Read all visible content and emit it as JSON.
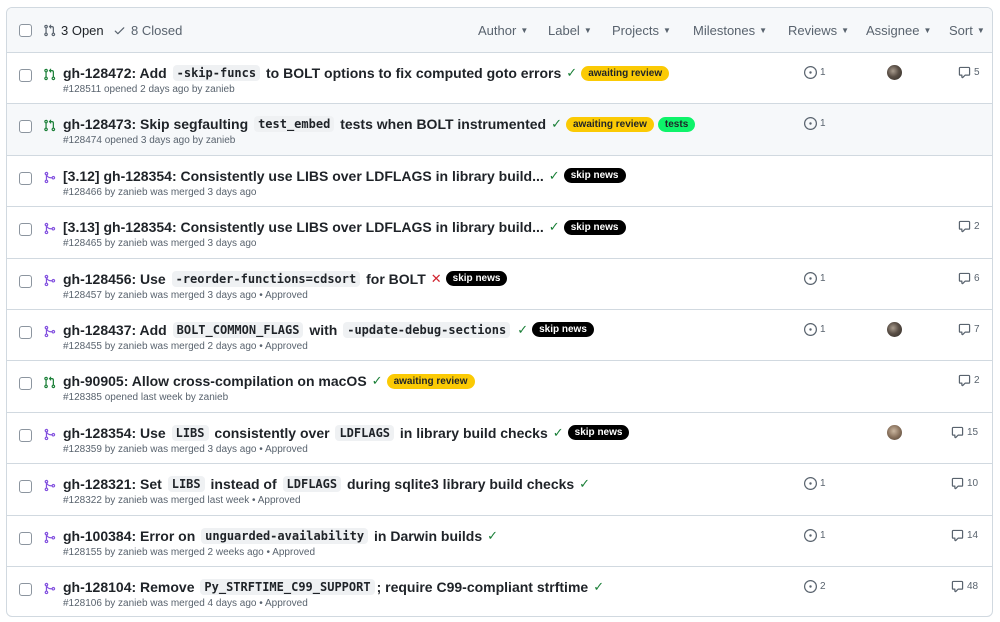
{
  "header": {
    "open_label": "3 Open",
    "closed_label": "8 Closed",
    "filters": [
      "Author",
      "Label",
      "Projects",
      "Milestones",
      "Reviews",
      "Assignee",
      "Sort"
    ]
  },
  "colors": {
    "open_icon": "#1a7f37",
    "merged_icon": "#8250df",
    "label_awaiting_review": "#fbca04",
    "label_tests": "#0ef36a",
    "label_skip_news": "#000000"
  },
  "pull_requests": [
    {
      "state": "open",
      "title_segments": [
        {
          "t": "gh-128472: Add "
        },
        {
          "c": "-skip-funcs"
        },
        {
          "t": " to BOLT options to fix computed goto errors"
        }
      ],
      "status": "check",
      "labels": [
        {
          "name": "awaiting review",
          "style": "awaiting"
        }
      ],
      "meta": "#128511 opened 2 days ago by zanieb",
      "reviews": "1",
      "avatar": "dark",
      "comments": "5",
      "highlighted": false
    },
    {
      "state": "open",
      "title_segments": [
        {
          "t": "gh-128473: Skip segfaulting "
        },
        {
          "c": "test_embed"
        },
        {
          "t": " tests when BOLT instrumented"
        }
      ],
      "status": "check",
      "labels": [
        {
          "name": "awaiting review",
          "style": "awaiting"
        },
        {
          "name": "tests",
          "style": "tests"
        }
      ],
      "meta": "#128474 opened 3 days ago by zanieb",
      "reviews": "1",
      "avatar": "",
      "comments": "",
      "highlighted": true
    },
    {
      "state": "merged",
      "title_segments": [
        {
          "t": "[3.12] gh-128354: Consistently use LIBS over LDFLAGS in library build..."
        }
      ],
      "status": "check",
      "labels": [
        {
          "name": "skip news",
          "style": "skip"
        }
      ],
      "meta": "#128466 by zanieb was merged 3 days ago",
      "reviews": "",
      "avatar": "",
      "comments": "",
      "highlighted": false
    },
    {
      "state": "merged",
      "title_segments": [
        {
          "t": "[3.13] gh-128354: Consistently use LIBS over LDFLAGS in library build..."
        }
      ],
      "status": "check",
      "labels": [
        {
          "name": "skip news",
          "style": "skip"
        }
      ],
      "meta": "#128465 by zanieb was merged 3 days ago",
      "reviews": "",
      "avatar": "",
      "comments": "2",
      "highlighted": false
    },
    {
      "state": "merged",
      "title_segments": [
        {
          "t": "gh-128456: Use "
        },
        {
          "c": "-reorder-functions=cdsort"
        },
        {
          "t": " for BOLT"
        }
      ],
      "status": "cross",
      "labels": [
        {
          "name": "skip news",
          "style": "skip"
        }
      ],
      "meta": "#128457 by zanieb was merged 3 days ago • Approved",
      "reviews": "1",
      "avatar": "",
      "comments": "6",
      "highlighted": false
    },
    {
      "state": "merged",
      "title_segments": [
        {
          "t": "gh-128437: Add "
        },
        {
          "c": "BOLT_COMMON_FLAGS"
        },
        {
          "t": " with "
        },
        {
          "c": "-update-debug-sections"
        }
      ],
      "status": "check",
      "labels": [
        {
          "name": "skip news",
          "style": "skip"
        }
      ],
      "meta": "#128455 by zanieb was merged 2 days ago • Approved",
      "reviews": "1",
      "avatar": "dark",
      "comments": "7",
      "highlighted": false
    },
    {
      "state": "open",
      "title_segments": [
        {
          "t": "gh-90905: Allow cross-compilation on macOS"
        }
      ],
      "status": "check",
      "labels": [
        {
          "name": "awaiting review",
          "style": "awaiting"
        }
      ],
      "meta": "#128385 opened last week by zanieb",
      "reviews": "",
      "avatar": "",
      "comments": "2",
      "highlighted": false
    },
    {
      "state": "merged",
      "title_segments": [
        {
          "t": "gh-128354: Use "
        },
        {
          "c": "LIBS"
        },
        {
          "t": " consistently over "
        },
        {
          "c": "LDFLAGS"
        },
        {
          "t": " in library build checks"
        }
      ],
      "status": "check",
      "labels": [
        {
          "name": "skip news",
          "style": "skip"
        }
      ],
      "meta": "#128359 by zanieb was merged 3 days ago • Approved",
      "reviews": "",
      "avatar": "light",
      "comments": "15",
      "highlighted": false
    },
    {
      "state": "merged",
      "title_segments": [
        {
          "t": "gh-128321: Set "
        },
        {
          "c": "LIBS"
        },
        {
          "t": " instead of "
        },
        {
          "c": "LDFLAGS"
        },
        {
          "t": " during sqlite3 library build checks"
        }
      ],
      "status": "check",
      "labels": [],
      "meta": "#128322 by zanieb was merged last week • Approved",
      "reviews": "1",
      "avatar": "",
      "comments": "10",
      "highlighted": false
    },
    {
      "state": "merged",
      "title_segments": [
        {
          "t": "gh-100384: Error on "
        },
        {
          "c": "unguarded-availability"
        },
        {
          "t": " in Darwin builds"
        }
      ],
      "status": "check",
      "labels": [],
      "meta": "#128155 by zanieb was merged 2 weeks ago • Approved",
      "reviews": "1",
      "avatar": "",
      "comments": "14",
      "highlighted": false
    },
    {
      "state": "merged",
      "title_segments": [
        {
          "t": "gh-128104: Remove "
        },
        {
          "c": "Py_STRFTIME_C99_SUPPORT"
        },
        {
          "t": "; require C99-compliant strftime"
        }
      ],
      "status": "check",
      "labels": [],
      "meta": "#128106 by zanieb was merged 4 days ago • Approved",
      "reviews": "2",
      "avatar": "",
      "comments": "48",
      "highlighted": false
    }
  ]
}
